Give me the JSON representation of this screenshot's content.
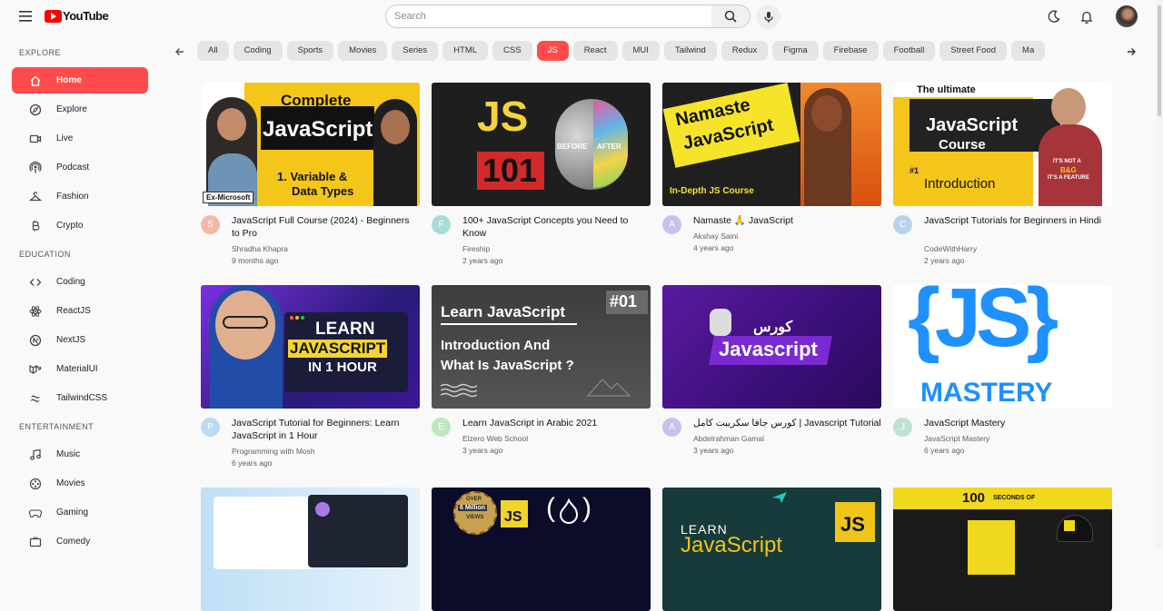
{
  "app": {
    "brand": "YouTube"
  },
  "search": {
    "placeholder": "Search"
  },
  "sidebar": {
    "sections": [
      {
        "title": "EXPLORE",
        "items": [
          {
            "label": "Home",
            "icon": "home-icon",
            "active": true
          },
          {
            "label": "Explore",
            "icon": "compass-icon"
          },
          {
            "label": "Live",
            "icon": "live-icon"
          },
          {
            "label": "Podcast",
            "icon": "podcast-icon"
          },
          {
            "label": "Fashion",
            "icon": "hanger-icon"
          },
          {
            "label": "Crypto",
            "icon": "bitcoin-icon"
          }
        ]
      },
      {
        "title": "EDUCATION",
        "items": [
          {
            "label": "Coding",
            "icon": "code-icon"
          },
          {
            "label": "ReactJS",
            "icon": "react-icon"
          },
          {
            "label": "NextJS",
            "icon": "nextjs-icon"
          },
          {
            "label": "MaterialUI",
            "icon": "mui-icon"
          },
          {
            "label": "TailwindCSS",
            "icon": "tailwind-icon"
          }
        ]
      },
      {
        "title": "ENTERTAINMENT",
        "items": [
          {
            "label": "Music",
            "icon": "music-icon"
          },
          {
            "label": "Movies",
            "icon": "film-icon"
          },
          {
            "label": "Gaming",
            "icon": "gamepad-icon"
          },
          {
            "label": "Comedy",
            "icon": "tv-icon"
          }
        ]
      }
    ]
  },
  "chips": {
    "items": [
      "All",
      "Coding",
      "Sports",
      "Movies",
      "Series",
      "HTML",
      "CSS",
      "JS",
      "React",
      "MUI",
      "Tailwind",
      "Redux",
      "Figma",
      "Firebase",
      "Football",
      "Street Food",
      "Ma"
    ],
    "active": "JS"
  },
  "videos": [
    {
      "title": "JavaScript Full Course (2024) - Beginners to Pro",
      "channel": "Shradha Khapra",
      "age": "9 months ago",
      "initial": "S",
      "avatar_color": "#f3b8a5"
    },
    {
      "title": "100+ JavaScript Concepts you Need to Know",
      "channel": "Fireship",
      "age": "2 years ago",
      "initial": "F",
      "avatar_color": "#a9dbd8"
    },
    {
      "title": "Namaste 🙏 JavaScript",
      "channel": "Akshay Saini",
      "age": "4 years ago",
      "initial": "A",
      "avatar_color": "#c5c3ee"
    },
    {
      "title": "JavaScript Tutorials for Beginners in Hindi",
      "channel": "CodeWithHarry",
      "age": "2 years ago",
      "initial": "C",
      "avatar_color": "#b9d3ef"
    },
    {
      "title": "JavaScript Tutorial for Beginners: Learn JavaScript in 1 Hour",
      "channel": "Programming with Mosh",
      "age": "6 years ago",
      "initial": "P",
      "avatar_color": "#b9dbf1"
    },
    {
      "title": "Learn JavaScript in Arabic 2021",
      "channel": "Elzero Web School",
      "age": "3 years ago",
      "initial": "E",
      "avatar_color": "#bfe6bf"
    },
    {
      "title": "كورس جافا سكريبت كامل | Javascript Tutorial",
      "channel": "Abdelrahman Gamal",
      "age": "3 years ago",
      "initial": "A",
      "avatar_color": "#c5c3ee"
    },
    {
      "title": "JavaScript Mastery",
      "channel": "JavaScript Mastery",
      "age": "6 years ago",
      "initial": "J",
      "avatar_color": "#bfe3d0"
    }
  ],
  "thumbs": {
    "t1": {
      "l1": "Complete",
      "l2": "JavaScript",
      "l3": "1. Variable &",
      "l4": "Data Types",
      "badge": "Ex-Microsoft"
    },
    "t2": {
      "l1": "JS",
      "l2": "101",
      "l3": "BEFORE",
      "l4": "AFTER"
    },
    "t3": {
      "l1": "Namaste",
      "l2": "JavaScript",
      "l3": "In-Depth JS Course"
    },
    "t4": {
      "l1": "The ultimate",
      "l2": "JavaScript",
      "l3": "Course",
      "l4": "#1",
      "l5": "Introduction",
      "l6": "IT'S NOT A",
      "l7": "B&G",
      "l8": "IT'S A FEATURE"
    },
    "t5": {
      "l1": "LEARN",
      "l2": "JAVASCRIPT",
      "l3": "IN 1 HOUR"
    },
    "t6": {
      "l1": "Learn JavaScript",
      "l2": "#01",
      "l3": "Introduction And",
      "l4": "What Is JavaScript ?"
    },
    "t7": {
      "l1": "كورس",
      "l2": "Javascript"
    },
    "t8": {
      "l1": "{JS}",
      "l2": "MASTERY"
    },
    "t9": {},
    "t10": {
      "l1": "OVER",
      "l2": "6 Million",
      "l3": "VIEWS",
      "l4": "JS"
    },
    "t11": {
      "l1": "LEARN",
      "l2": "JavaScript",
      "l3": "JS"
    },
    "t12": {
      "l1": "100",
      "l2": "SECONDS OF"
    }
  },
  "colors": {
    "accent": "#ff4b4b",
    "brand_red": "#ff0000"
  }
}
